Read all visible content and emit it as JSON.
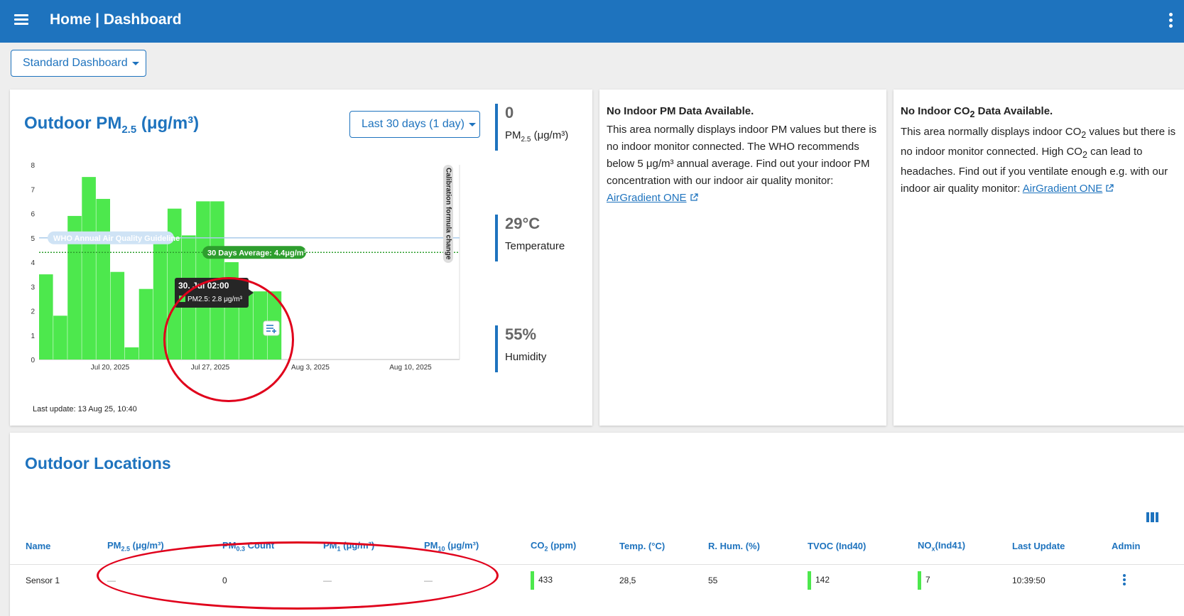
{
  "app": {
    "title": "Home | Dashboard",
    "accent": "#1e73be"
  },
  "dashboard_select": {
    "label": "Standard Dashboard"
  },
  "chart_card": {
    "title_main": "Outdoor PM",
    "title_sub": "2.5",
    "title_unit": " (μg/m³)",
    "range_label": "Last 30 days (1 day)",
    "last_update": "Last update: 13 Aug 25, 10:40",
    "stats": [
      {
        "value": "0",
        "label_main": "PM",
        "label_sub": "2.5",
        "label_unit": " (μg/m³)"
      },
      {
        "value": "29°C",
        "label": "Temperature"
      },
      {
        "value": "55%",
        "label": "Humidity"
      }
    ]
  },
  "chart_data": {
    "type": "bar",
    "ylim": [
      0,
      8
    ],
    "yticks": [
      "0",
      "1",
      "2",
      "3",
      "4",
      "5",
      "6",
      "7",
      "8"
    ],
    "xticks": [
      "Jul 20, 2025",
      "Jul 27, 2025",
      "Aug 3, 2025",
      "Aug 10, 2025"
    ],
    "values": [
      3.5,
      1.8,
      5.9,
      7.5,
      6.6,
      3.6,
      0.5,
      2.9,
      5.1,
      6.2,
      5.1,
      6.5,
      6.5,
      4.0,
      2.8,
      2.8,
      2.8
    ],
    "bar_color": "#4de84d",
    "guideline": {
      "label": "WHO Annual Air Quality Guideline",
      "value": 5,
      "color": "#a9cbe9"
    },
    "average": {
      "label": "30 Days Average: 4.4μg/m³",
      "value": 4.4,
      "color": "#2e9e2e"
    },
    "annotation": "Calibration formula change",
    "tooltip": {
      "title": "30. Jul  02:00",
      "text": "PM2.5: 2.8 μg/m³"
    }
  },
  "pm_card": {
    "title": "No Indoor PM Data Available.",
    "body": "This area normally displays indoor PM values but there is no indoor monitor connected. The WHO recommends below 5 μg/m³ annual average. Find out your indoor PM concentration with our indoor air quality monitor:",
    "link": "AirGradient ONE"
  },
  "co2_card": {
    "title_a": "No Indoor CO",
    "title_sub": "2",
    "title_b": " Data Available.",
    "body_a": "This area normally displays indoor CO",
    "body_sub": "2",
    "body_b": " values but there is no indoor monitor connected. High CO",
    "body_sub2": "2",
    "body_c": " can lead to headaches. Find out if you ventilate enough e.g. with our indoor air quality monitor:",
    "link": "AirGradient ONE"
  },
  "locations": {
    "title": "Outdoor Locations",
    "headers": {
      "name": "Name",
      "pm25_a": "PM",
      "pm25_sub": "2.5",
      "pm25_b": " (μg/m³)",
      "pm03_a": "PM",
      "pm03_sub": "0.3",
      "pm03_b": " Count",
      "pm1_a": "PM",
      "pm1_sub": "1",
      "pm1_b": " (μg/m³)",
      "pm10_a": "PM",
      "pm10_sub": "10",
      "pm10_b": " (μg/m³)",
      "co2_a": "CO",
      "co2_sub": "2",
      "co2_b": " (ppm)",
      "temp": "Temp. (°C)",
      "hum": "R. Hum. (%)",
      "tvoc": "TVOC (Ind40)",
      "nox_a": "NO",
      "nox_sub": "x",
      "nox_b": "(Ind41)",
      "last": "Last Update",
      "admin": "Admin"
    },
    "row": {
      "name": "Sensor 1",
      "pm25": "—",
      "pm03": "0",
      "pm1": "—",
      "pm10": "—",
      "co2": "433",
      "temp": "28,5",
      "hum": "55",
      "tvoc": "142",
      "nox": "7",
      "last": "10:39:50"
    }
  }
}
